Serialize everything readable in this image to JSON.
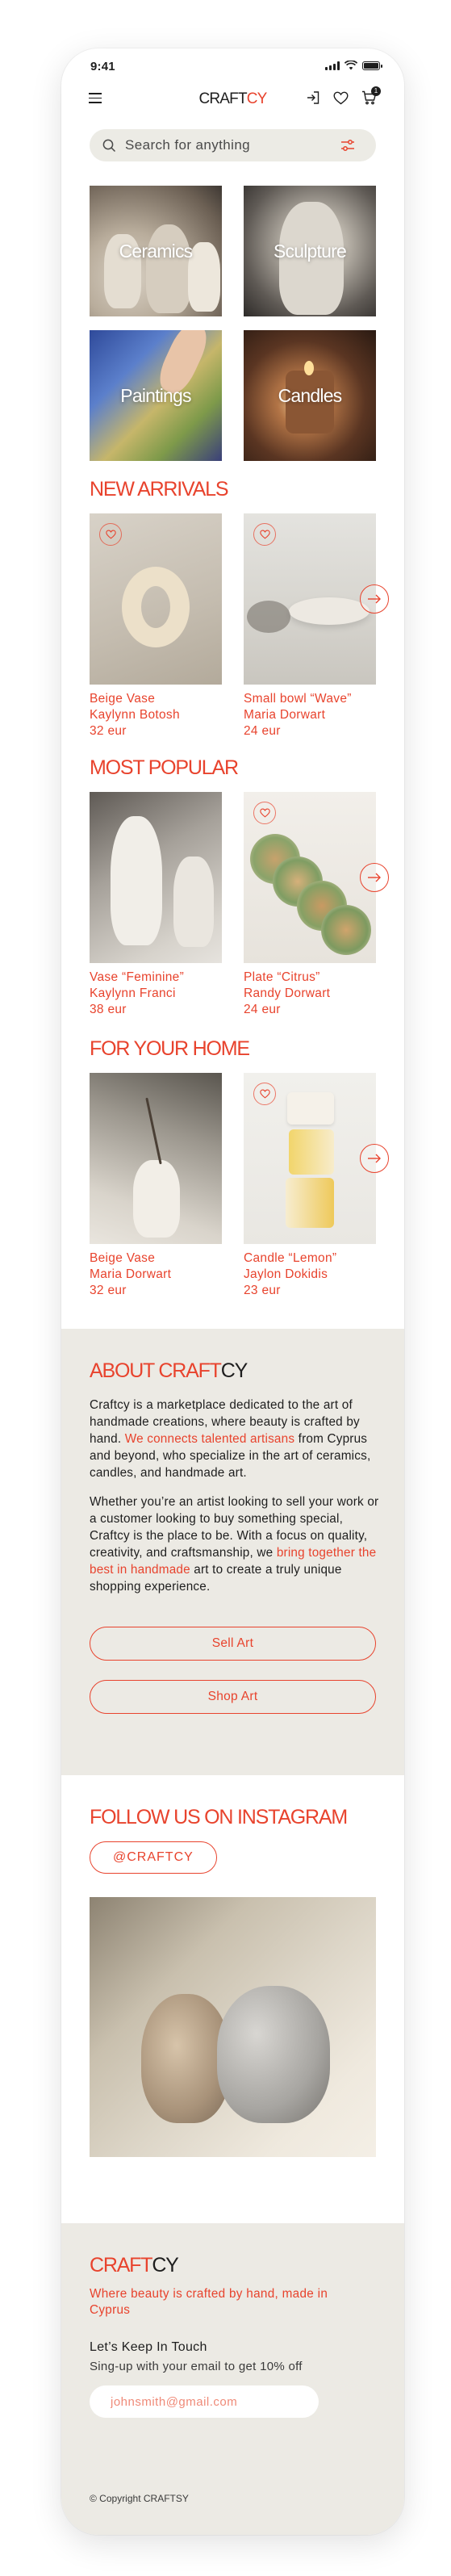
{
  "status_bar": {
    "time": "9:41"
  },
  "header": {
    "logo_part1": "CRAFT",
    "logo_part2": "CY"
  },
  "search": {
    "placeholder": "Search for anything"
  },
  "categories": [
    {
      "label": "Ceramics"
    },
    {
      "label": "Sculpture"
    },
    {
      "label": "Paintings"
    },
    {
      "label": "Candles"
    }
  ],
  "sections": {
    "new_arrivals": {
      "title": "NEW ARRIVALS",
      "products": [
        {
          "name": "Beige Vase",
          "artist": "Kaylynn Botosh",
          "price": "32 eur"
        },
        {
          "name": "Small bowl “Wave”",
          "artist": "Maria Dorwart",
          "price": "24 eur"
        }
      ]
    },
    "most_popular": {
      "title": "MOST POPULAR",
      "products": [
        {
          "name": "Vase “Feminine”",
          "artist": "Kaylynn Franci",
          "price": "38 eur"
        },
        {
          "name": "Plate “Citrus”",
          "artist": "Randy Dorwart",
          "price": "24 eur"
        }
      ]
    },
    "for_your_home": {
      "title": "FOR YOUR HOME",
      "products": [
        {
          "name": "Beige Vase",
          "artist": "Maria Dorwart",
          "price": "32 eur"
        },
        {
          "name": "Candle “Lemon”",
          "artist": "Jaylon Dokidis",
          "price": "23 eur"
        }
      ]
    }
  },
  "about": {
    "title_part1": "ABOUT CRAFT",
    "title_part2": "CY",
    "p1_a": "Craftcy is a marketplace dedicated to the art of handmade creations, where beauty is crafted by hand. ",
    "p1_hl": "We connects talented artisans",
    "p1_b": " from Cyprus and beyond, who specialize in the art of ceramics, candles, and handmade art.",
    "p2_a": "Whether you’re an artist looking to sell your work or a customer looking to buy something special, Craftcy is the place to be. With a focus on quality, creativity, and craftsmanship, we ",
    "p2_hl": "bring together the best in handmade",
    "p2_b": " art to create a truly unique shopping experience.",
    "sell_button": "Sell Art",
    "shop_button": "Shop Art"
  },
  "instagram": {
    "title": "FOLLOW US ON INSTAGRAM",
    "handle": "@CRAFTCY"
  },
  "footer": {
    "logo_part1": "CRAFT",
    "logo_part2": "CY",
    "tagline": "Where beauty is crafted by hand, made in Cyprus",
    "keep_in_touch": "Let’s Keep In Touch",
    "signup_text": "Sing-up with your email to get 10% off",
    "email_placeholder": "johnsmith@gmail.com",
    "copyright": "© Copyright CRAFTSY"
  },
  "colors": {
    "accent": "#e8432d",
    "text": "#1e1e1e",
    "panel": "#eceae4"
  }
}
